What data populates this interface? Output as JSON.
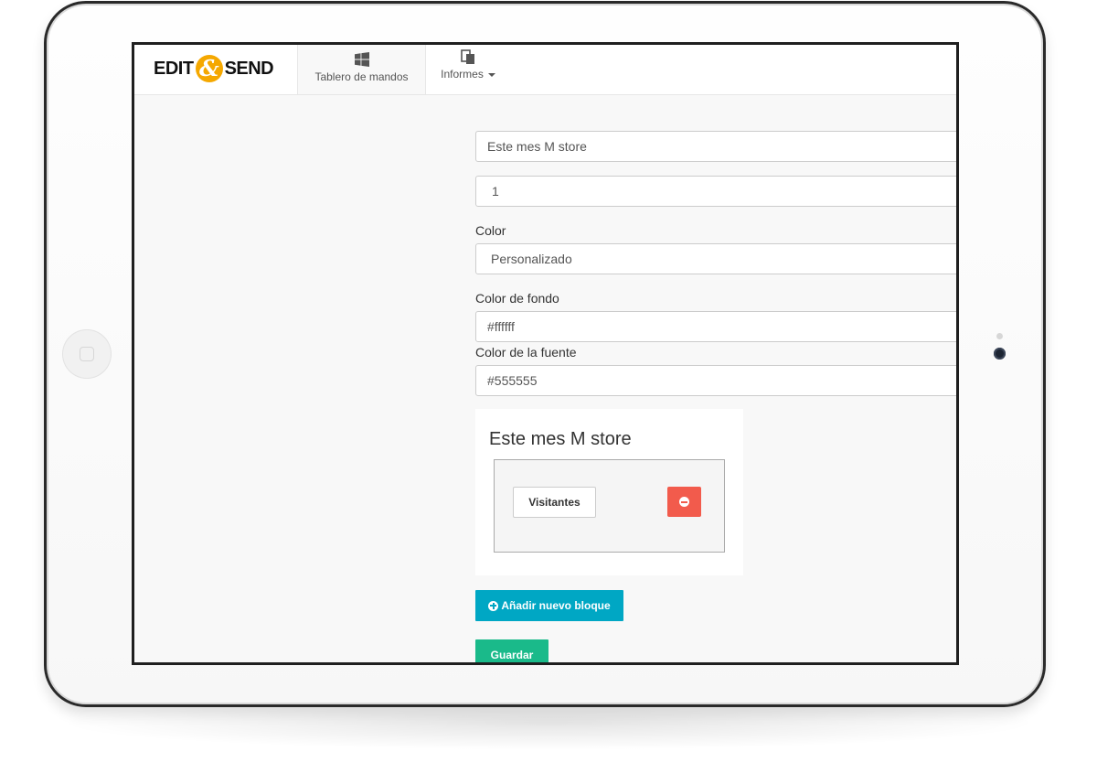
{
  "brand": {
    "logo_left": "EDIT",
    "logo_amp": "&",
    "logo_right": "SEND"
  },
  "nav": {
    "tabs": [
      {
        "label": "Tablero de mandos",
        "icon": "windows-icon",
        "active": true
      },
      {
        "label": "Informes",
        "icon": "reports-icon",
        "active": false,
        "dropdown": true
      }
    ]
  },
  "form": {
    "block_title_value": "Este mes M store",
    "order_value": "1",
    "color_label": "Color",
    "color_value": "Personalizado",
    "bg_color_label": "Color de fondo",
    "bg_color_value": "#ffffff",
    "font_color_label": "Color de la fuente",
    "font_color_value": "#555555"
  },
  "preview": {
    "title": "Este mes M store",
    "block_button_label": "Visitantes"
  },
  "actions": {
    "add_block_label": "Añadir nuevo bloque",
    "save_label": "Guardar"
  },
  "colors": {
    "accent_add": "#00a7c4",
    "accent_save": "#1aba8a",
    "remove": "#f25b4c",
    "logo_amp": "#f5a800"
  }
}
